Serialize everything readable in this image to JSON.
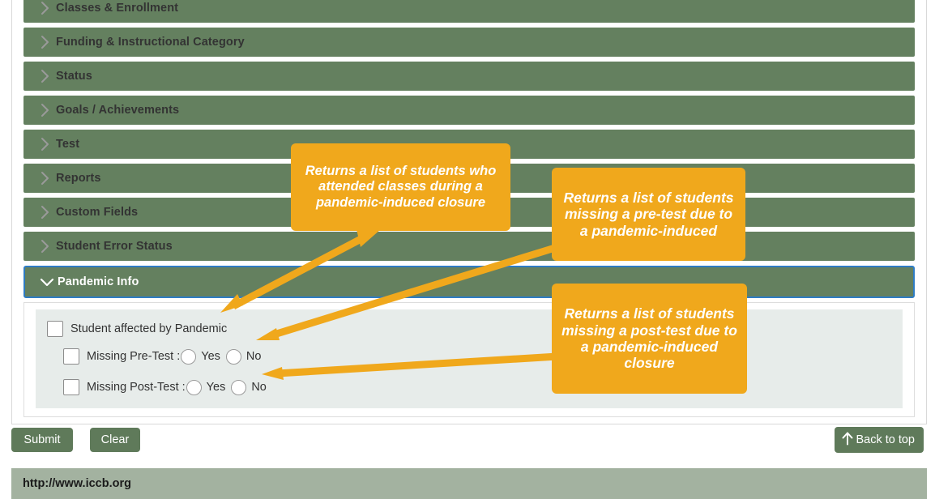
{
  "accordion": {
    "rows": [
      {
        "label": "Classes & Enrollment",
        "expanded": false,
        "chevron": "chevron-right-icon"
      },
      {
        "label": "Funding & Instructional Category",
        "expanded": false,
        "chevron": "chevron-right-icon"
      },
      {
        "label": "Status",
        "expanded": false,
        "chevron": "chevron-right-icon"
      },
      {
        "label": "Goals / Achievements",
        "expanded": false,
        "chevron": "chevron-right-icon"
      },
      {
        "label": "Test",
        "expanded": false,
        "chevron": "chevron-right-icon"
      },
      {
        "label": "Reports",
        "expanded": false,
        "chevron": "chevron-right-icon"
      },
      {
        "label": "Custom Fields",
        "expanded": false,
        "chevron": "chevron-right-icon"
      },
      {
        "label": "Student Error Status",
        "expanded": false,
        "chevron": "chevron-right-icon"
      },
      {
        "label": "Pandemic Info",
        "expanded": true,
        "chevron": "chevron-down-icon"
      }
    ]
  },
  "pandemic_panel": {
    "affected_checkbox_label": "Student affected by Pandemic",
    "affected_checked": false,
    "pre_test": {
      "checkbox_label": "Missing Pre-Test :",
      "checked": false,
      "yes_label": "Yes",
      "no_label": "No",
      "selected": ""
    },
    "post_test": {
      "checkbox_label": "Missing Post-Test :",
      "checked": false,
      "yes_label": "Yes",
      "no_label": "No",
      "selected": ""
    }
  },
  "buttons": {
    "submit": "Submit",
    "clear": "Clear",
    "back_to_top": "Back to top",
    "back_to_top_icon": "arrow-up-icon"
  },
  "footer": {
    "url": "http://www.iccb.org"
  },
  "annotations": {
    "callout_1": "Returns a list of students who attended classes during a pandemic-induced closure",
    "callout_2": "Returns a list of students missing a pre-test due to a pandemic-induced",
    "callout_3": "Returns a list of students missing a post-test due to a pandemic-induced closure"
  },
  "colors": {
    "accordion_green": "#64805f",
    "panel_body": "#e7ecea",
    "callout_orange": "#f0a81c",
    "button_green": "#5f7a5a",
    "footer_green": "#a3b2a0",
    "focus_blue": "#2e7cc4"
  }
}
